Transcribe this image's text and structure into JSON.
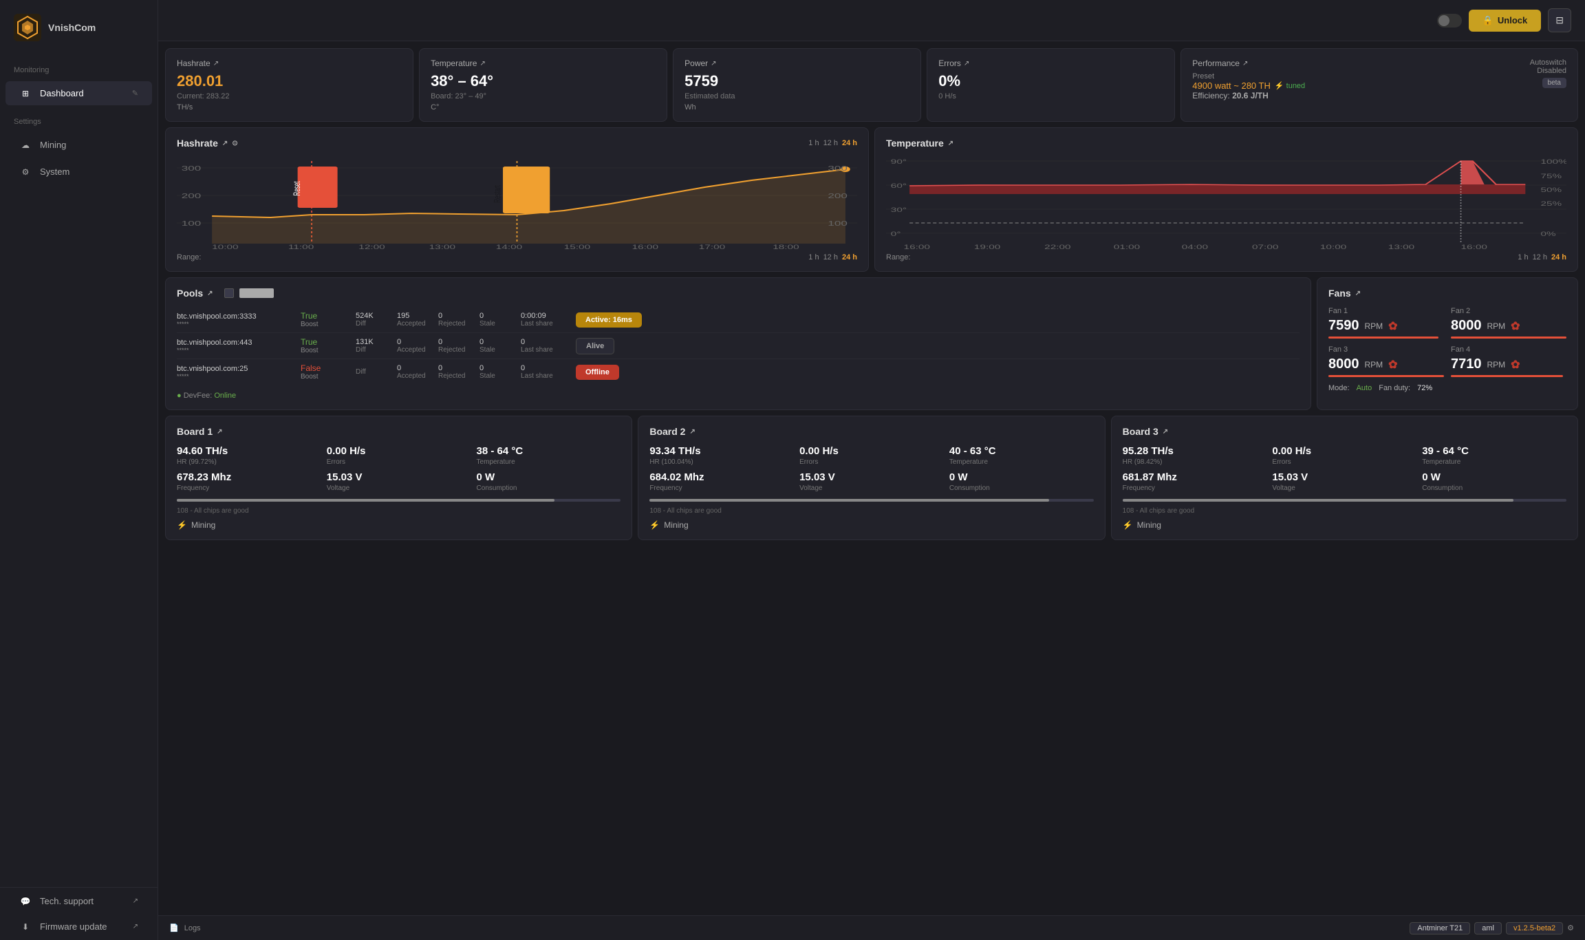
{
  "sidebar": {
    "logo_text": "VnishCom",
    "monitoring_label": "Monitoring",
    "settings_label": "Settings",
    "items": [
      {
        "id": "dashboard",
        "label": "Dashboard",
        "active": true
      },
      {
        "id": "mining",
        "label": "Mining",
        "active": false
      },
      {
        "id": "system",
        "label": "System",
        "active": false
      },
      {
        "id": "tech_support",
        "label": "Tech. support",
        "active": false
      },
      {
        "id": "firmware_update",
        "label": "Firmware update",
        "active": false
      }
    ]
  },
  "topbar": {
    "unlock_label": "Unlock"
  },
  "stats": {
    "hashrate": {
      "title": "Hashrate",
      "value": "280.01",
      "sub": "Current: 283.22",
      "unit": "TH/s"
    },
    "temperature": {
      "title": "Temperature",
      "value": "38° – 64°",
      "sub": "Board: 23° – 49°",
      "unit": "C°"
    },
    "power": {
      "title": "Power",
      "value": "5759",
      "sub": "Estimated data",
      "unit": "Wh"
    },
    "errors": {
      "title": "Errors",
      "value": "0%",
      "sub": "0 H/s",
      "unit": ""
    },
    "performance": {
      "title": "Performance",
      "preset_label": "Preset",
      "preset_value": "4900 watt ~ 280 TH",
      "tuned": "tuned",
      "autoswitch_label": "Autoswitch",
      "autoswitch_value": "Disabled",
      "efficiency_label": "Efficiency:",
      "efficiency_value": "20.6 J/TH",
      "beta": "beta"
    }
  },
  "hashrate_chart": {
    "title": "Hashrate",
    "range_1h": "1 h",
    "range_12h": "12 h",
    "range_24h": "24 h",
    "active_range": "24 h",
    "y_labels": [
      "300",
      "200",
      "100"
    ],
    "x_labels": [
      "10:00",
      "11:00",
      "12:00",
      "13:00",
      "14:00",
      "15:00",
      "16:00",
      "17:00",
      "18:00"
    ],
    "reset_label": "Reset",
    "restart_label": "Restart"
  },
  "temperature_chart": {
    "title": "Temperature",
    "range_1h": "1 h",
    "range_12h": "12 h",
    "range_24h": "24 h",
    "active_range": "24 h",
    "y_labels": [
      "90°",
      "60°",
      "30°",
      "0°"
    ],
    "y_pct": [
      "100%",
      "75%",
      "50%",
      "25%",
      "0%"
    ],
    "x_labels": [
      "16:00",
      "19:00",
      "22:00",
      "01:00",
      "04:00",
      "07:00",
      "10:00",
      "13:00",
      "16:00"
    ]
  },
  "pools": {
    "title": "Pools",
    "items": [
      {
        "url": "btc.vnishpool.com:3333",
        "stars": "*****",
        "boost": "True\nBoost",
        "boost_val": "True",
        "diff": "524K",
        "accepted": "195",
        "rejected": "0",
        "stale": "0",
        "last_share": "0:00:09",
        "status": "Active: 16ms",
        "status_type": "active"
      },
      {
        "url": "btc.vnishpool.com:443",
        "stars": "*****",
        "boost_val": "True",
        "diff": "131K",
        "accepted": "0",
        "rejected": "0",
        "stale": "0",
        "last_share": "0",
        "status": "Alive",
        "status_type": "alive"
      },
      {
        "url": "btc.vnishpool.com:25",
        "stars": "*****",
        "boost_val": "False",
        "diff": "",
        "accepted": "0",
        "rejected": "0",
        "stale": "0",
        "last_share": "0",
        "status": "Offline",
        "status_type": "offline"
      }
    ],
    "devfee_label": "DevFee:",
    "devfee_status": "Online"
  },
  "fans": {
    "title": "Fans",
    "fan1_label": "Fan 1",
    "fan1_value": "7590",
    "fan1_unit": "RPM",
    "fan2_label": "Fan 2",
    "fan2_value": "8000",
    "fan2_unit": "RPM",
    "fan3_label": "Fan 3",
    "fan3_value": "8000",
    "fan3_unit": "RPM",
    "fan4_label": "Fan 4",
    "fan4_value": "7710",
    "fan4_unit": "RPM",
    "mode_label": "Mode:",
    "mode_value": "Auto",
    "duty_label": "Fan duty:",
    "duty_value": "72%"
  },
  "boards": [
    {
      "title": "Board 1",
      "hashrate": "94.60 TH/s",
      "hashrate_sub": "HR (99.72%)",
      "errors": "0.00 H/s",
      "errors_label": "Errors",
      "temp": "38 - 64 °C",
      "temp_label": "Temperature",
      "frequency": "678.23 Mhz",
      "freq_label": "Frequency",
      "voltage": "15.03 V",
      "volt_label": "Voltage",
      "consumption": "0 W",
      "cons_label": "Consumption",
      "chips_label": "108 - All chips are good",
      "status": "Mining"
    },
    {
      "title": "Board 2",
      "hashrate": "93.34 TH/s",
      "hashrate_sub": "HR (100.04%)",
      "errors": "0.00 H/s",
      "errors_label": "Errors",
      "temp": "40 - 63 °C",
      "temp_label": "Temperature",
      "frequency": "684.02 Mhz",
      "freq_label": "Frequency",
      "voltage": "15.03 V",
      "volt_label": "Voltage",
      "consumption": "0 W",
      "cons_label": "Consumption",
      "chips_label": "108 - All chips are good",
      "status": "Mining"
    },
    {
      "title": "Board 3",
      "hashrate": "95.28 TH/s",
      "hashrate_sub": "HR (98.42%)",
      "errors": "0.00 H/s",
      "errors_label": "Errors",
      "temp": "39 - 64 °C",
      "temp_label": "Temperature",
      "frequency": "681.87 Mhz",
      "freq_label": "Frequency",
      "voltage": "15.03 V",
      "volt_label": "Voltage",
      "consumption": "0 W",
      "cons_label": "Consumption",
      "chips_label": "108 - All chips are good",
      "status": "Mining"
    }
  ],
  "bottom": {
    "logs_label": "Logs",
    "device": "Antminer T21",
    "algo": "aml",
    "version": "v1.2.5-beta2"
  }
}
